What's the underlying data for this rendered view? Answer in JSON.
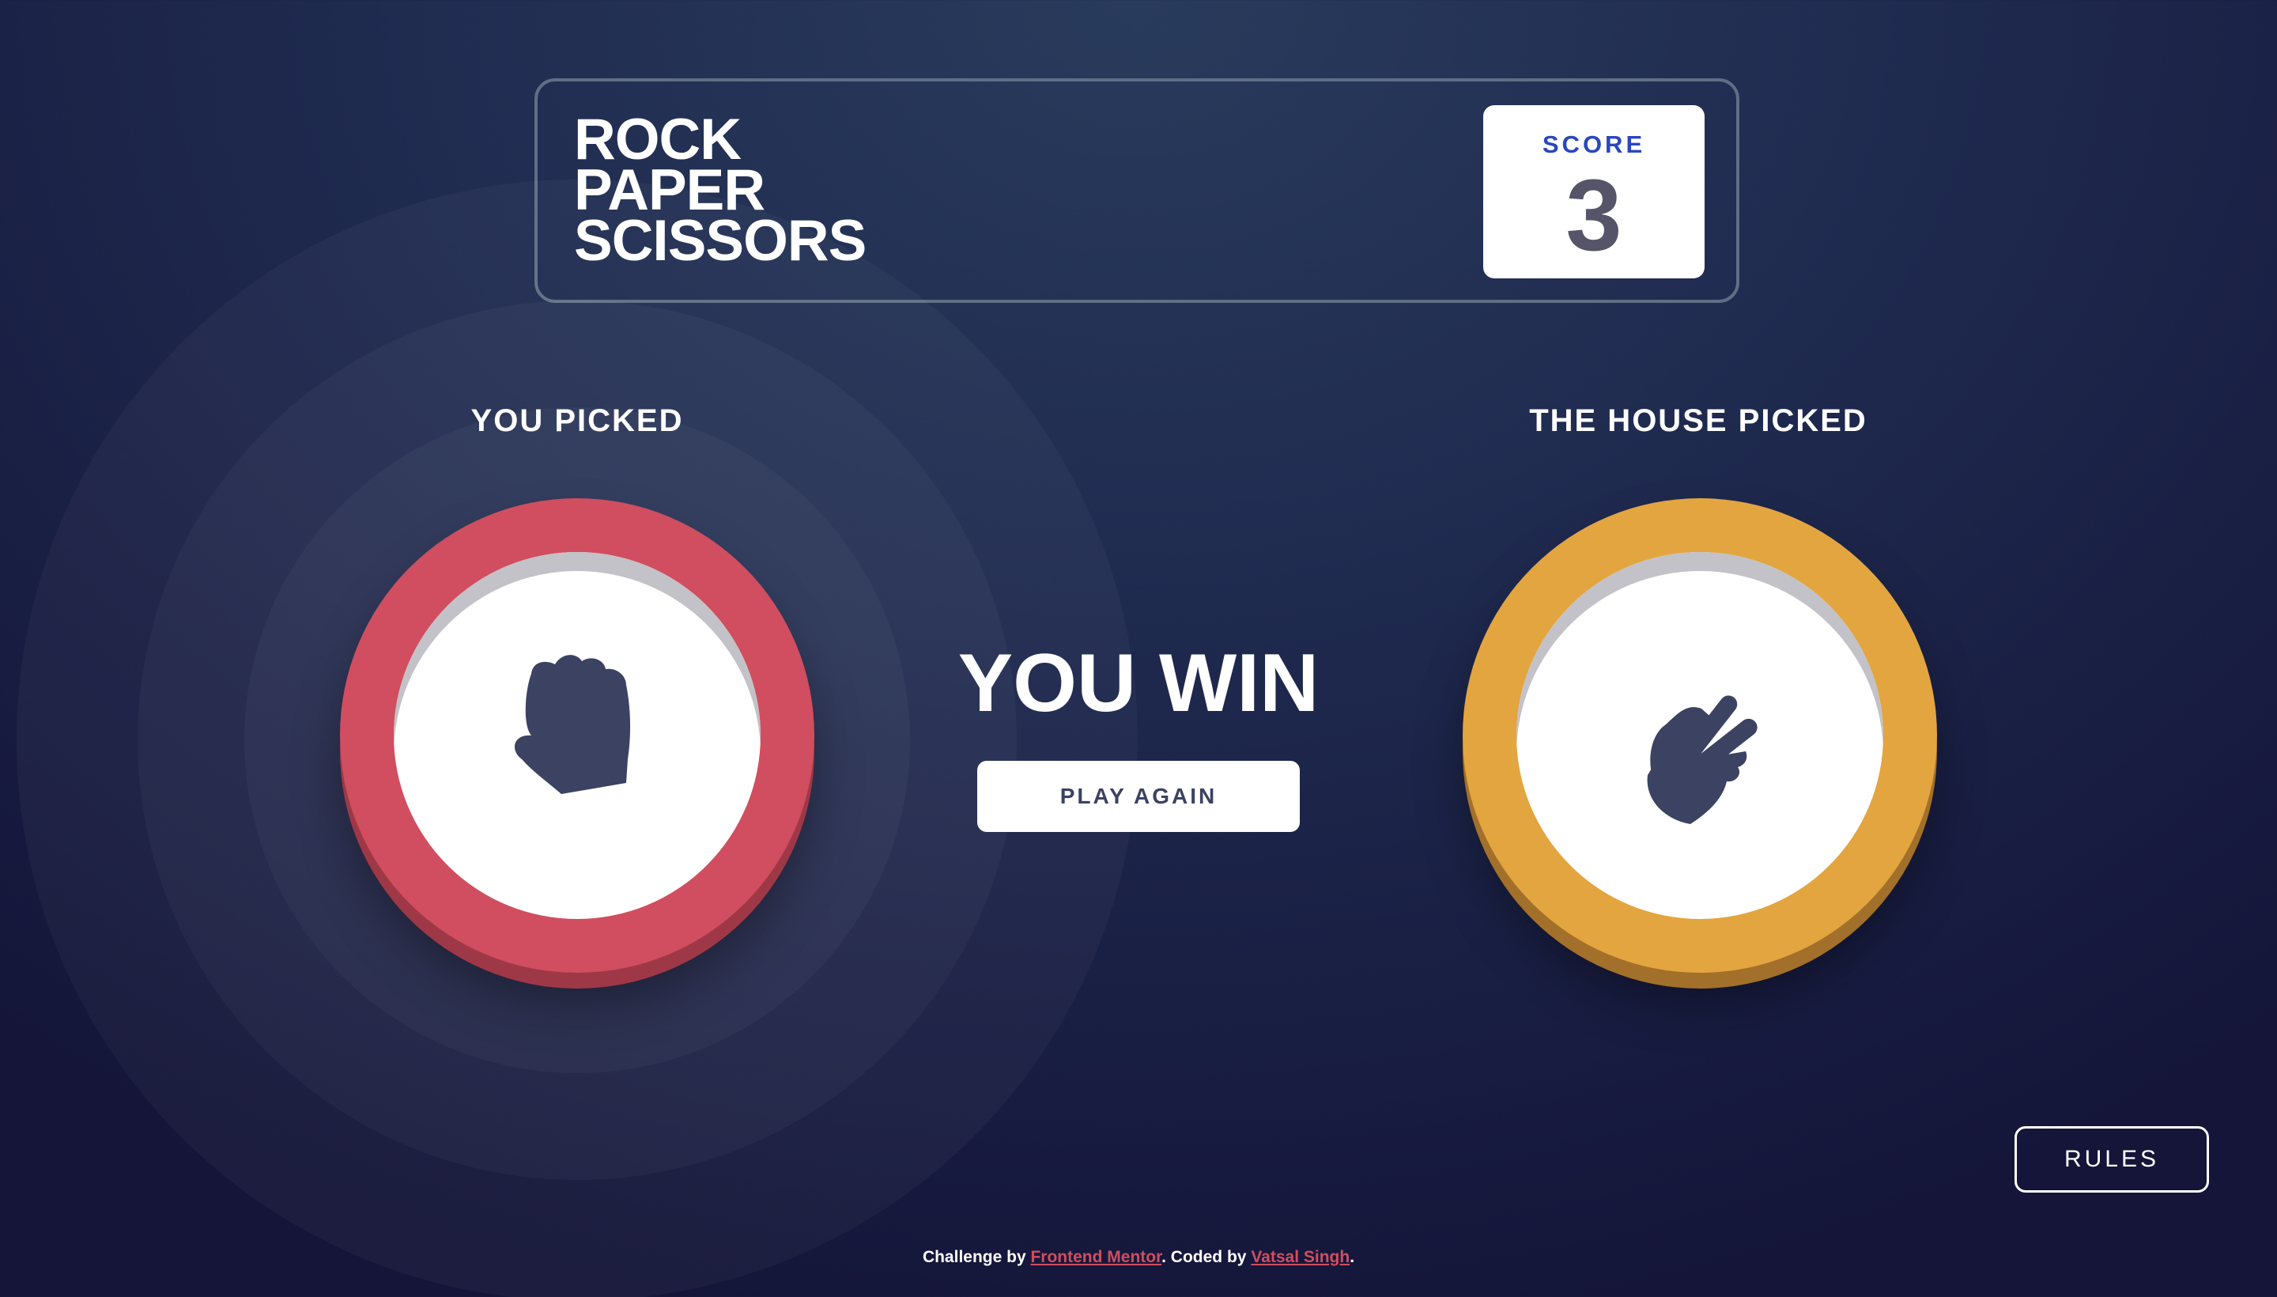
{
  "header": {
    "title_lines": [
      "ROCK",
      "PAPER",
      "SCISSORS"
    ],
    "score_label": "SCORE",
    "score_value": "3"
  },
  "game": {
    "player_label": "YOU PICKED",
    "house_label": "THE HOUSE PICKED",
    "player_choice": "rock-icon",
    "house_choice": "scissors-icon",
    "result_text": "YOU WIN",
    "play_again_label": "PLAY AGAIN"
  },
  "rules": {
    "button_label": "RULES"
  },
  "footer": {
    "prefix": "Challenge by",
    "link1": "Frontend Mentor",
    "middle": ". Coded by",
    "link2": "Vatsal Singh",
    "suffix": "."
  },
  "colors": {
    "background": "#1f2a4f",
    "rock": "#d04e5f",
    "scissors": "#e3a53f",
    "score_label": "#2a46c0",
    "score_value": "#565468",
    "button_text": "#3b4262",
    "link": "#d04e5f"
  }
}
